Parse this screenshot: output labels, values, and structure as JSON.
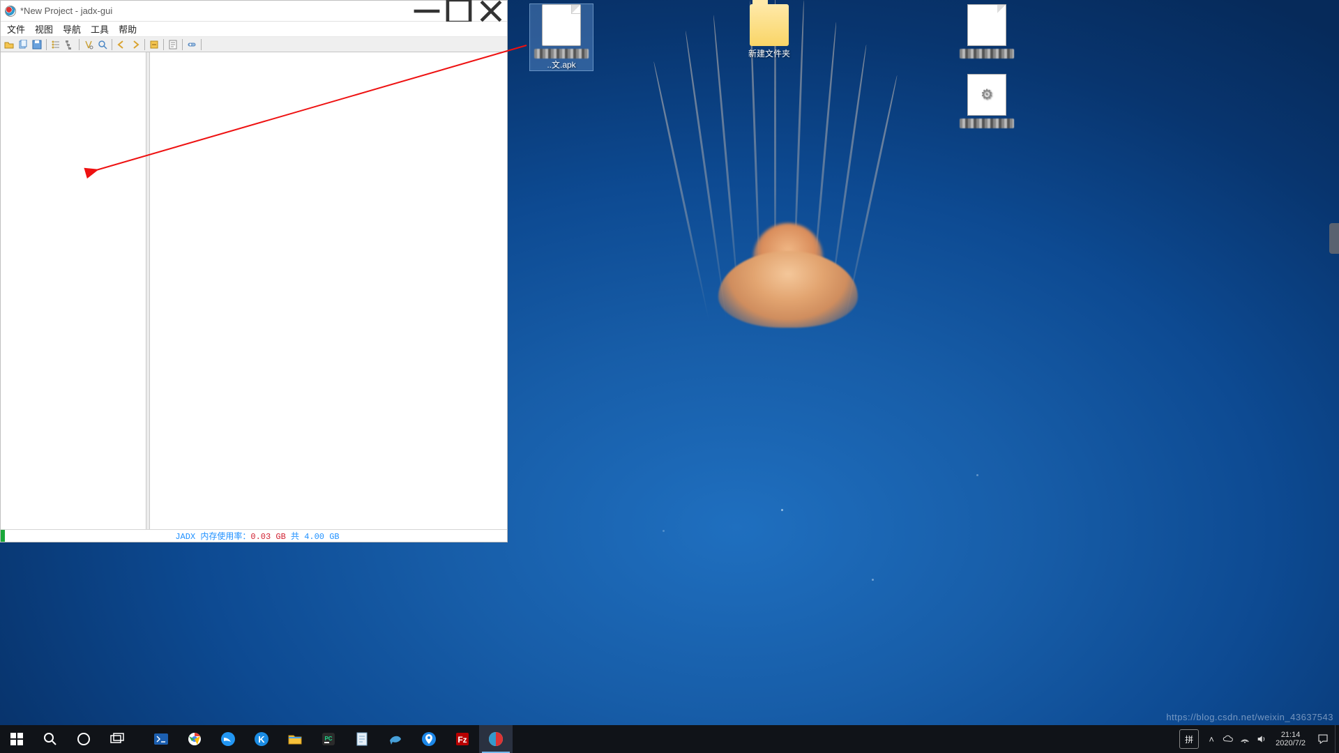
{
  "window": {
    "title": "*New Project - jadx-gui"
  },
  "menu": {
    "file": "文件",
    "view": "视图",
    "navigate": "导航",
    "tools": "工具",
    "help": "帮助"
  },
  "toolbar": {
    "icons": [
      "open-file",
      "sync",
      "save",
      "|",
      "tree-flat",
      "tree-hier",
      "|",
      "wand",
      "deobf",
      "|",
      "back",
      "forward",
      "|",
      "search-class",
      "|",
      "log",
      "|",
      "settings"
    ]
  },
  "status": {
    "prefix": "JADX 内存使用率：",
    "used": "0.03 GB",
    "mid": " 共 ",
    "total": "4.00 GB"
  },
  "desktop_icons": {
    "apk": {
      "label": "..文.apk",
      "selected": true
    },
    "folder": {
      "label": "新建文件夹"
    },
    "file2": {
      "label_hidden": true
    },
    "file3": {
      "label_hidden": true
    }
  },
  "taskbar": {
    "apps": [
      {
        "name": "start",
        "glyph": "win"
      },
      {
        "name": "search",
        "glyph": "search"
      },
      {
        "name": "cortana",
        "glyph": "circle"
      },
      {
        "name": "task-view",
        "glyph": "taskview"
      },
      {
        "name": "powershell",
        "glyph": "ps",
        "color": "#1c64b8"
      },
      {
        "name": "chrome",
        "glyph": "chrome"
      },
      {
        "name": "dingtalk",
        "glyph": "ding",
        "color": "#2296f3"
      },
      {
        "name": "kodi",
        "glyph": "k",
        "color": "#1b8ce3"
      },
      {
        "name": "explorer",
        "glyph": "folder",
        "color": "#f8c23a"
      },
      {
        "name": "pycharm",
        "glyph": "pc",
        "color": "#2b2b2b"
      },
      {
        "name": "notepad",
        "glyph": "note",
        "color": "#a9d0e6"
      },
      {
        "name": "mysql",
        "glyph": "dolphin",
        "color": "#47a0d9"
      },
      {
        "name": "locator",
        "glyph": "pin",
        "color": "#1c87e8"
      },
      {
        "name": "filezilla",
        "glyph": "fz",
        "color": "#b80000"
      },
      {
        "name": "jadx",
        "glyph": "jadx",
        "active": true
      }
    ],
    "tray": {
      "ime": "拼",
      "up_arrow": "˄",
      "onedrive": "☁",
      "net": "🖧",
      "vol": "🔊",
      "time": "21:14",
      "date": "2020/7/2",
      "notify": "💬"
    }
  },
  "watermark": "https://blog.csdn.net/weixin_43637543"
}
